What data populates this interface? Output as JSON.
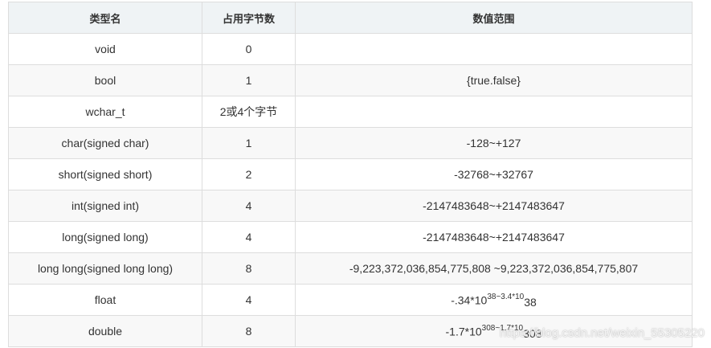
{
  "table": {
    "headers": [
      "类型名",
      "占用字节数",
      "数值范围"
    ],
    "rows": [
      {
        "type": "void",
        "bytes": "0",
        "range": ""
      },
      {
        "type": "bool",
        "bytes": "1",
        "range": "{true.false}"
      },
      {
        "type": "wchar_t",
        "bytes": "2或4个字节",
        "range": ""
      },
      {
        "type": "char(signed char)",
        "bytes": "1",
        "range": "-128~+127"
      },
      {
        "type": "short(signed short)",
        "bytes": "2",
        "range": "-32768~+32767"
      },
      {
        "type": "int(signed int)",
        "bytes": "4",
        "range": "-2147483648~+2147483647"
      },
      {
        "type": "long(signed long)",
        "bytes": "4",
        "range": "-2147483648~+2147483647"
      },
      {
        "type": "long long(signed long long)",
        "bytes": "8",
        "range": "-9,223,372,036,854,775,808 ~9,223,372,036,854,775,807"
      },
      {
        "type": "float",
        "bytes": "4",
        "range_parts": {
          "a": "-.34*10",
          "sup1": "38~3.4*10",
          "b": "38"
        }
      },
      {
        "type": "double",
        "bytes": "8",
        "range_parts": {
          "a": "-1.7*10",
          "sup1": "308~1.7*10",
          "b": "308"
        }
      }
    ]
  },
  "watermark": "https://blog.csdn.net/weixin_55305220",
  "colors": {
    "header_bg": "#eff3f5",
    "stripe_bg": "#f8f8f8",
    "border": "#dddddd",
    "text": "#333333"
  }
}
